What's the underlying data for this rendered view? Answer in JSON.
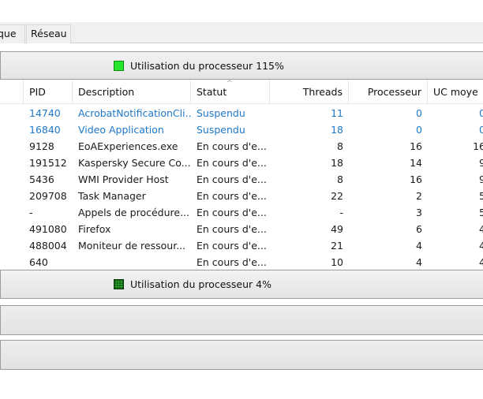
{
  "tabs": [
    {
      "label": "que"
    },
    {
      "label": "Réseau"
    }
  ],
  "cpu_section": {
    "label": "Utilisation du processeur 115%",
    "indicator_color": "#27e52a"
  },
  "table": {
    "columns": [
      "PID",
      "Description",
      "Statut",
      "Threads",
      "Processeur",
      "UC moye"
    ],
    "rows": [
      {
        "pid": "14740",
        "description": "AcrobatNotificationCli...",
        "status": "Suspendu",
        "threads": "11",
        "cpu": "0",
        "avg": "0",
        "suspended": true
      },
      {
        "pid": "16840",
        "description": "Video Application",
        "status": "Suspendu",
        "threads": "18",
        "cpu": "0",
        "avg": "0",
        "suspended": true
      },
      {
        "pid": "9128",
        "description": "EoAExperiences.exe",
        "status": "En cours d'e...",
        "threads": "8",
        "cpu": "16",
        "avg": "16",
        "suspended": false
      },
      {
        "pid": "191512",
        "description": "Kaspersky Secure Co...",
        "status": "En cours d'e...",
        "threads": "18",
        "cpu": "14",
        "avg": "9",
        "suspended": false
      },
      {
        "pid": "5436",
        "description": "WMI Provider Host",
        "status": "En cours d'e...",
        "threads": "8",
        "cpu": "16",
        "avg": "9",
        "suspended": false
      },
      {
        "pid": "209708",
        "description": "Task Manager",
        "status": "En cours d'e...",
        "threads": "22",
        "cpu": "2",
        "avg": "5",
        "suspended": false
      },
      {
        "pid": "-",
        "description": "Appels de procédure...",
        "status": "En cours d'e...",
        "threads": "-",
        "cpu": "3",
        "avg": "5",
        "suspended": false
      },
      {
        "pid": "491080",
        "description": "Firefox",
        "status": "En cours d'e...",
        "threads": "49",
        "cpu": "6",
        "avg": "4",
        "suspended": false
      },
      {
        "pid": "488004",
        "description": "Moniteur de ressour...",
        "status": "En cours d'e...",
        "threads": "21",
        "cpu": "4",
        "avg": "4",
        "suspended": false
      },
      {
        "pid": "640",
        "description": "",
        "status": "En cours d'e...",
        "threads": "10",
        "cpu": "4",
        "avg": "4",
        "suspended": false
      }
    ]
  },
  "disk_section": {
    "label": "Utilisation du processeur 4%",
    "indicator_color": "#105c10"
  },
  "colors": {
    "suspended_text": "#1f78c8",
    "header_border": "#9c9c9c"
  }
}
